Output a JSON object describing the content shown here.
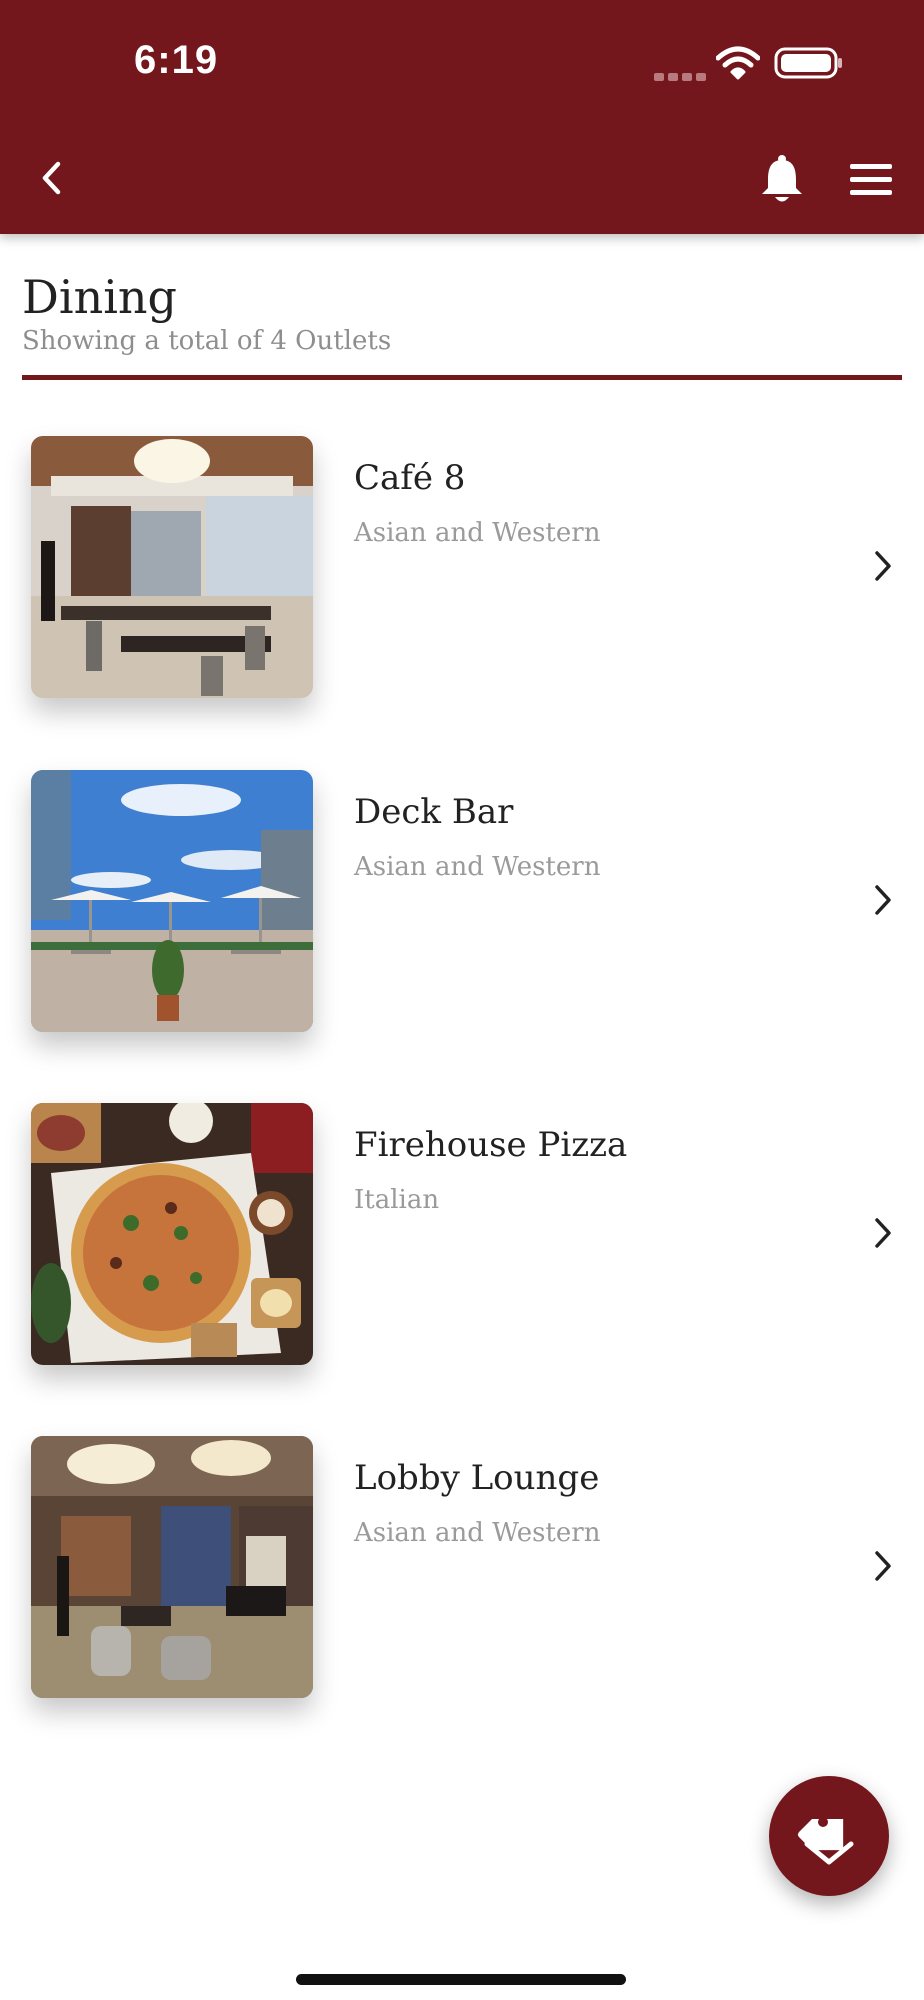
{
  "status_bar": {
    "time": "6:19"
  },
  "header": {
    "back_icon": "chevron-left-icon",
    "notification_icon": "bell-icon",
    "menu_icon": "hamburger-menu-icon",
    "background_color": "#74171d"
  },
  "page": {
    "title": "Dining",
    "subtitle": "Showing a total of 4 Outlets"
  },
  "outlets": [
    {
      "name": "Café 8",
      "cuisine": "Asian and Western"
    },
    {
      "name": "Deck Bar",
      "cuisine": "Asian and Western"
    },
    {
      "name": "Firehouse Pizza",
      "cuisine": "Italian"
    },
    {
      "name": "Lobby Lounge",
      "cuisine": "Asian and Western"
    }
  ],
  "fab": {
    "icon": "tag-icon"
  },
  "colors": {
    "accent": "#74171d",
    "title_text": "#222222",
    "secondary_text": "#9a9a9a"
  }
}
